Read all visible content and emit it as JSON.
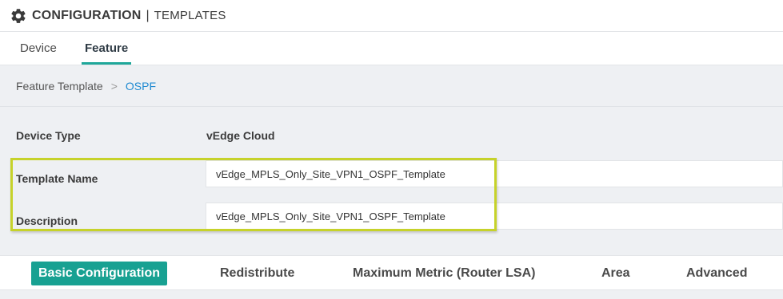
{
  "header": {
    "title": "CONFIGURATION",
    "separator": "|",
    "subtitle": "TEMPLATES",
    "icon": "gear-icon"
  },
  "tabs": [
    {
      "label": "Device",
      "active": false
    },
    {
      "label": "Feature",
      "active": true
    }
  ],
  "breadcrumb": {
    "parent": "Feature Template",
    "separator": ">",
    "current": "OSPF"
  },
  "form": {
    "device_type_label": "Device Type",
    "device_type_value": "vEdge Cloud",
    "template_name_label": "Template Name",
    "template_name_value": "vEdge_MPLS_Only_Site_VPN1_OSPF_Template",
    "description_label": "Description",
    "description_value": "vEdge_MPLS_Only_Site_VPN1_OSPF_Template"
  },
  "section_tabs": [
    {
      "label": "Basic Configuration",
      "active": true
    },
    {
      "label": "Redistribute",
      "active": false
    },
    {
      "label": "Maximum Metric (Router LSA)",
      "active": false
    },
    {
      "label": "Area",
      "active": false
    },
    {
      "label": "Advanced",
      "active": false
    }
  ],
  "colors": {
    "accent": "#18a192",
    "link": "#1f8ad1",
    "highlight": "#c6d22a"
  }
}
